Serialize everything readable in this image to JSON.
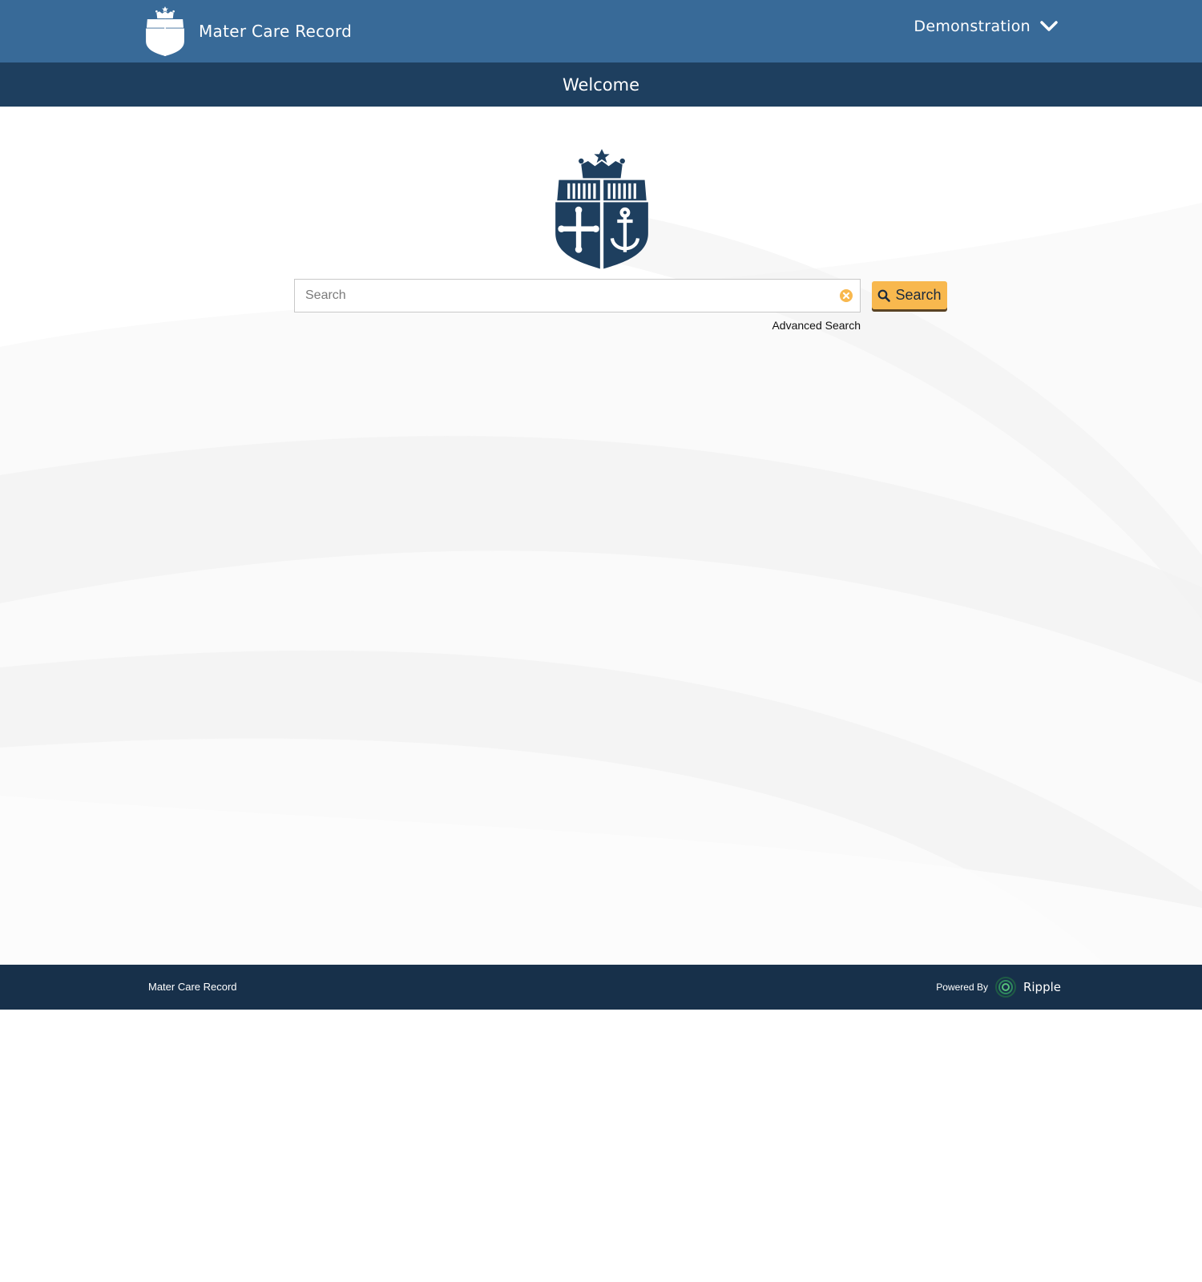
{
  "header": {
    "app_title": "Mater Care Record",
    "user_menu_label": "Demonstration",
    "logo_icon": "mater-crest-icon",
    "menu_icon": "chevron-down-icon"
  },
  "title_bar": {
    "title": "Welcome"
  },
  "main": {
    "logo_icon": "mater-crest-icon",
    "search": {
      "value": "",
      "placeholder": "Search",
      "clear_icon": "clear-icon",
      "button_label": "Search",
      "button_icon": "magnifier-icon"
    },
    "advanced_search_link": "Advanced Search"
  },
  "footer": {
    "left_text": "Mater Care Record",
    "powered_by_label": "Powered By",
    "powered_by_brand": "Ripple",
    "brand_icon": "ripple-logo-icon"
  },
  "colors": {
    "header_bg": "#386a98",
    "title_bar_bg": "#1e3f5f",
    "footer_bg": "#17304a",
    "crest": "#1e3f5f",
    "accent": "#f8b84e",
    "content_bg": "#fafafa"
  }
}
